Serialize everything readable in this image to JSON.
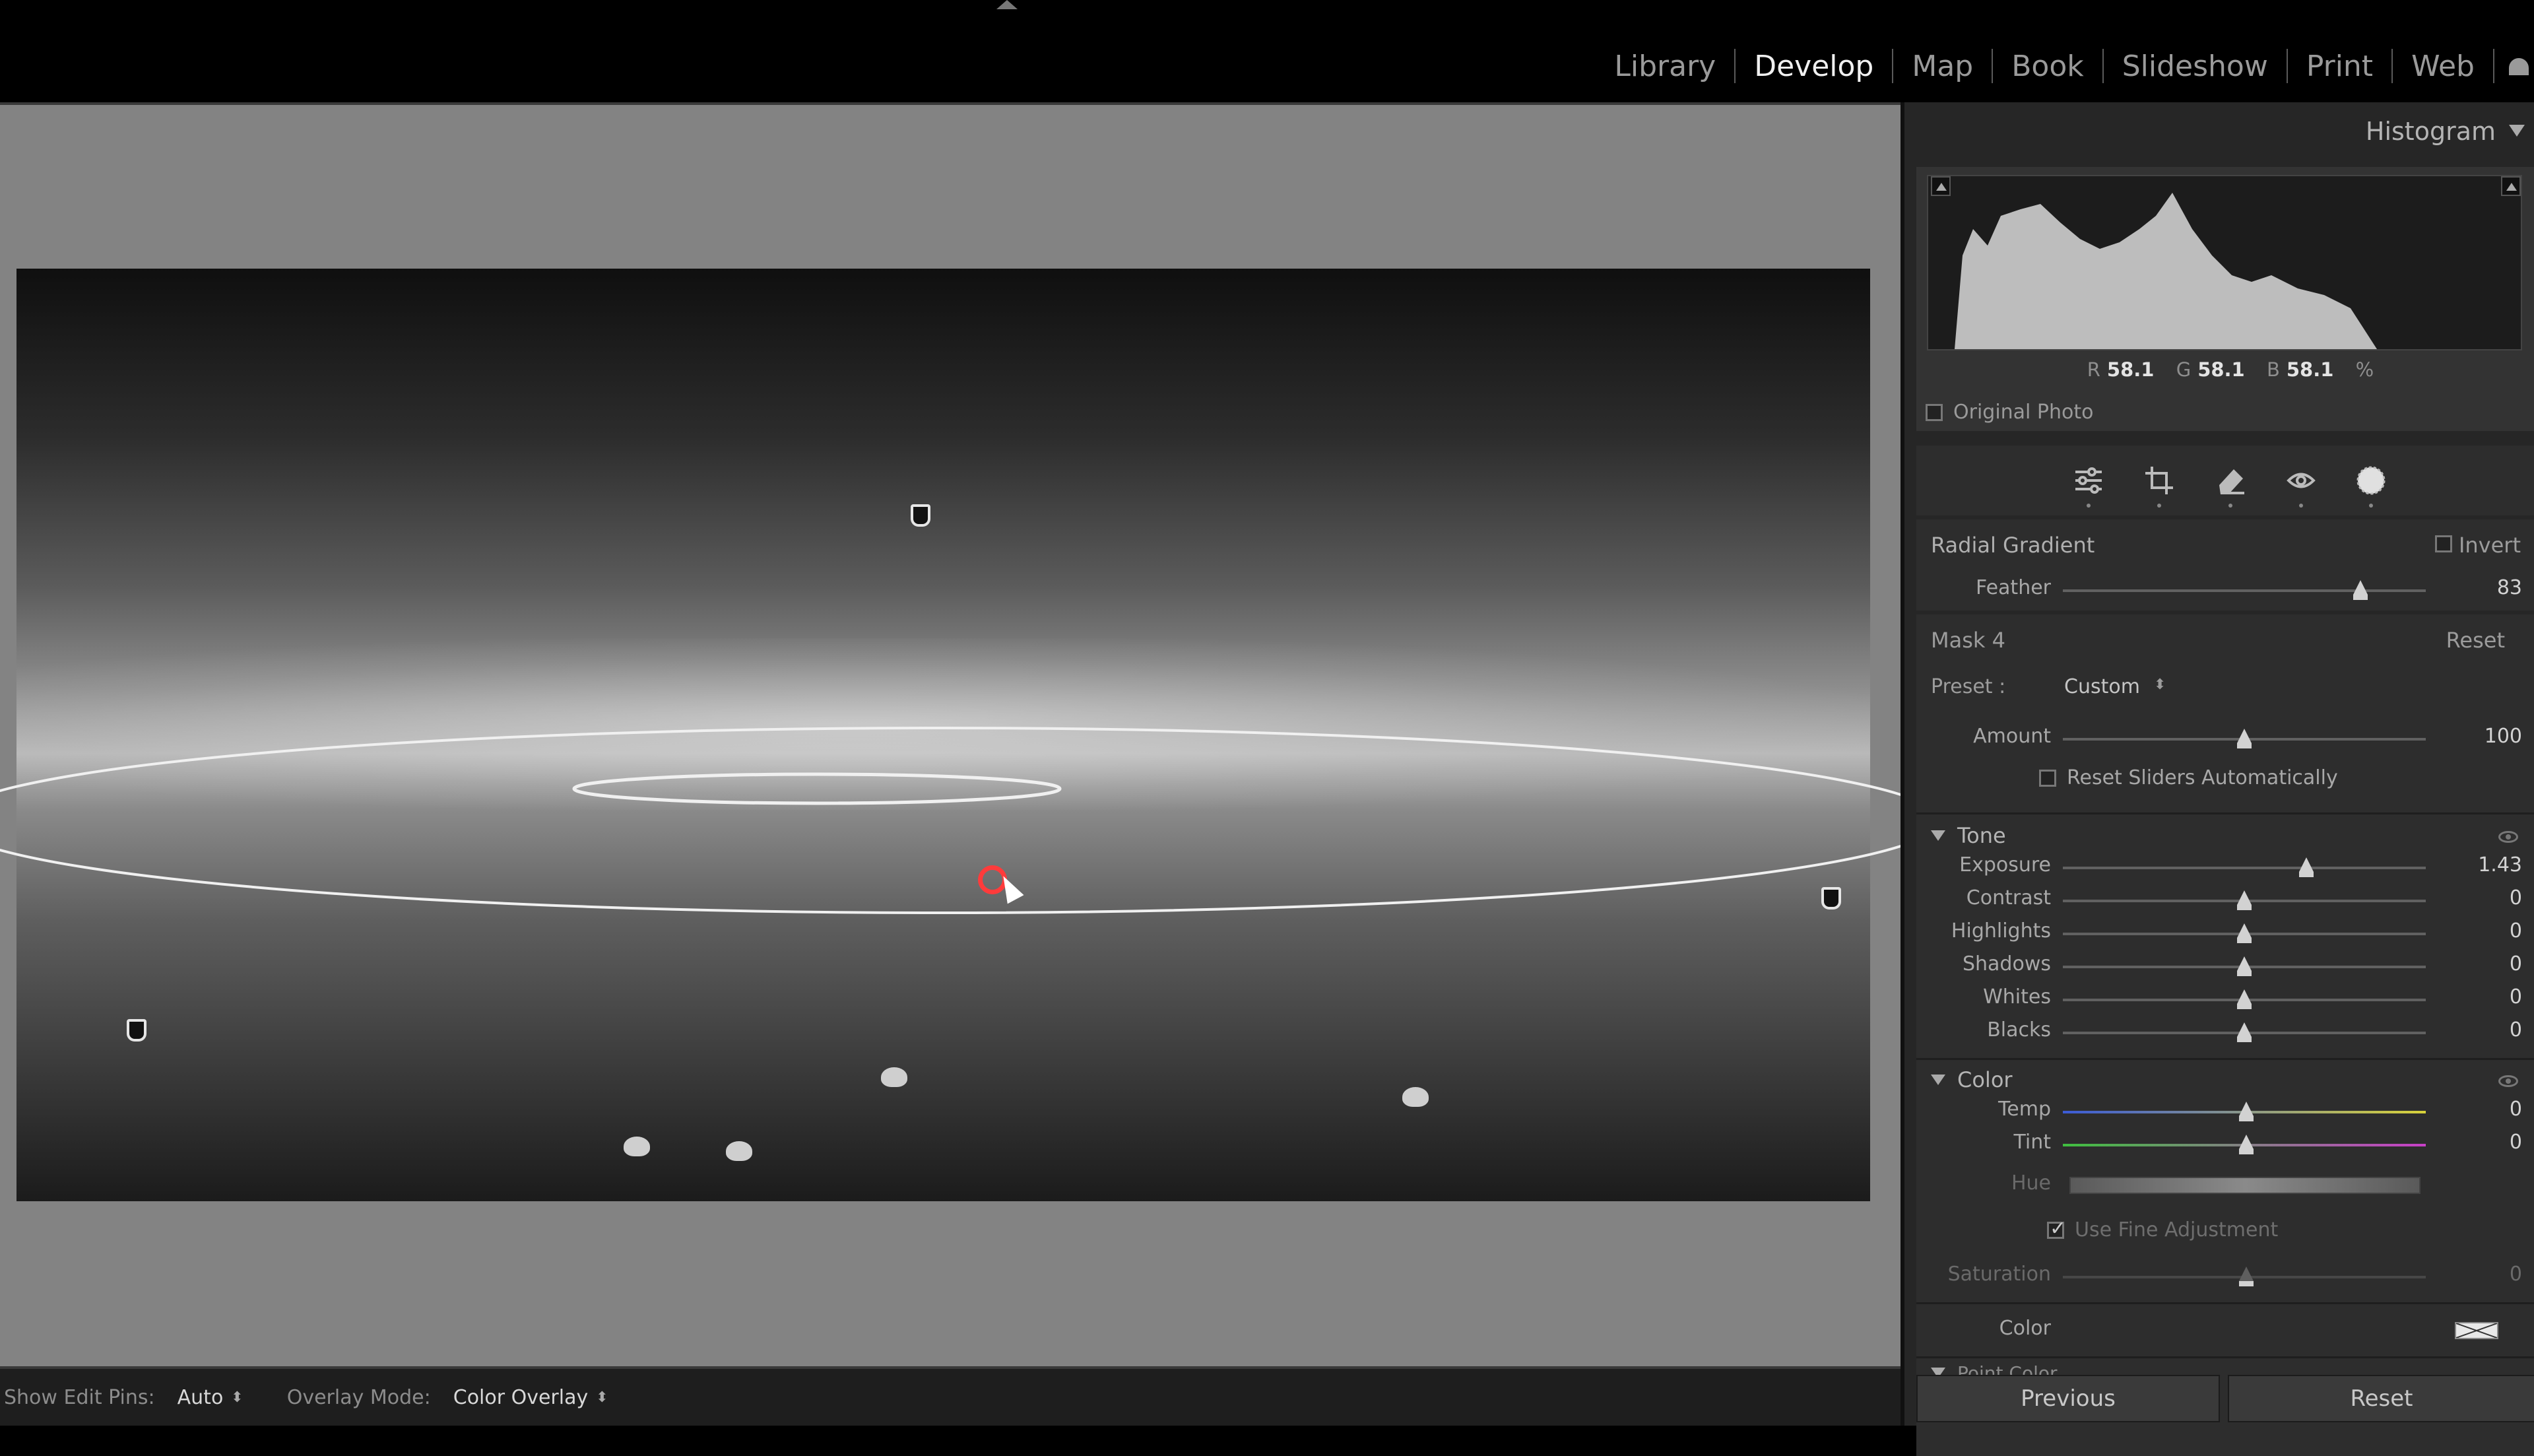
{
  "modules": {
    "items": [
      "Library",
      "Develop",
      "Map",
      "Book",
      "Slideshow",
      "Print",
      "Web"
    ],
    "active": "Develop"
  },
  "bottombar": {
    "edit_pins_label": "Show Edit Pins:",
    "edit_pins_value": "Auto",
    "overlay_label": "Overlay Mode:",
    "overlay_value": "Color Overlay"
  },
  "histogram": {
    "title": "Histogram",
    "r_label": "R",
    "r_value": "58.1",
    "g_label": "G",
    "g_value": "58.1",
    "b_label": "B",
    "b_value": "58.1",
    "percent": "%",
    "original_photo": "Original Photo"
  },
  "radial": {
    "title": "Radial Gradient",
    "invert_label": "Invert",
    "feather_label": "Feather",
    "feather_value": "83",
    "feather_level": 0.82
  },
  "mask": {
    "title": "Mask 4",
    "reset_label": "Reset",
    "preset_label": "Preset :",
    "preset_value": "Custom",
    "amount_label": "Amount",
    "amount_value": "100",
    "amount_level": 0.5,
    "reset_sliders_label": "Reset Sliders Automatically"
  },
  "tone": {
    "title": "Tone",
    "sliders": [
      {
        "label": "Exposure",
        "value": "1.43",
        "level": 0.67
      },
      {
        "label": "Contrast",
        "value": "0",
        "level": 0.5
      },
      {
        "label": "Highlights",
        "value": "0",
        "level": 0.5
      },
      {
        "label": "Shadows",
        "value": "0",
        "level": 0.5
      },
      {
        "label": "Whites",
        "value": "0",
        "level": 0.5
      },
      {
        "label": "Blacks",
        "value": "0",
        "level": 0.5
      }
    ]
  },
  "color": {
    "title": "Color",
    "temp_label": "Temp",
    "temp_value": "0",
    "tint_label": "Tint",
    "tint_value": "0",
    "hue_label": "Hue",
    "fine_label": "Use Fine Adjustment",
    "saturation_label": "Saturation",
    "saturation_value": "0",
    "color_label": "Color",
    "point_color_label": "Point Color"
  },
  "buttons": {
    "previous": "Previous",
    "reset": "Reset"
  },
  "colors": {
    "accent_cursor": "#ff3b3b",
    "panel_bg": "#2d2d2d"
  },
  "icons": [
    "sliders-icon",
    "crop-icon",
    "eraser-icon",
    "red-eye-icon",
    "mask-icon"
  ]
}
